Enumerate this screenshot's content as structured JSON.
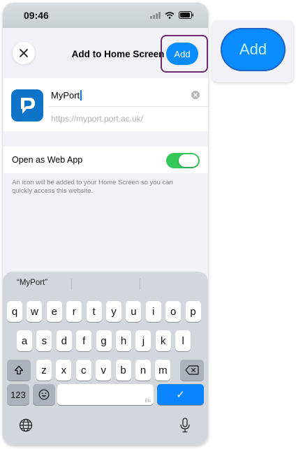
{
  "status_bar": {
    "time": "09:46"
  },
  "sheet": {
    "title": "Add to Home Screen",
    "add_label": "Add",
    "app_name": "MyPort",
    "url": "https://myport.port.ac.uk/",
    "web_app_label": "Open as Web App",
    "web_app_enabled": true,
    "footnote": "An icon will be added to your Home Screen so you can quickly access this website."
  },
  "keyboard": {
    "suggestion": "“MyPort”",
    "row1": [
      "q",
      "w",
      "e",
      "r",
      "t",
      "y",
      "u",
      "i",
      "o",
      "p"
    ],
    "row2": [
      "a",
      "s",
      "d",
      "f",
      "g",
      "h",
      "j",
      "k",
      "l"
    ],
    "row3": [
      "z",
      "x",
      "c",
      "v",
      "b",
      "n",
      "m"
    ],
    "numbers_label": "123",
    "space_lang": "EN",
    "return_symbol": "✓"
  },
  "zoom": {
    "add_label": "Add"
  },
  "colors": {
    "accent": "#0a8cff",
    "toggle_on": "#35c759",
    "highlight_border": "#6b2b6e"
  }
}
